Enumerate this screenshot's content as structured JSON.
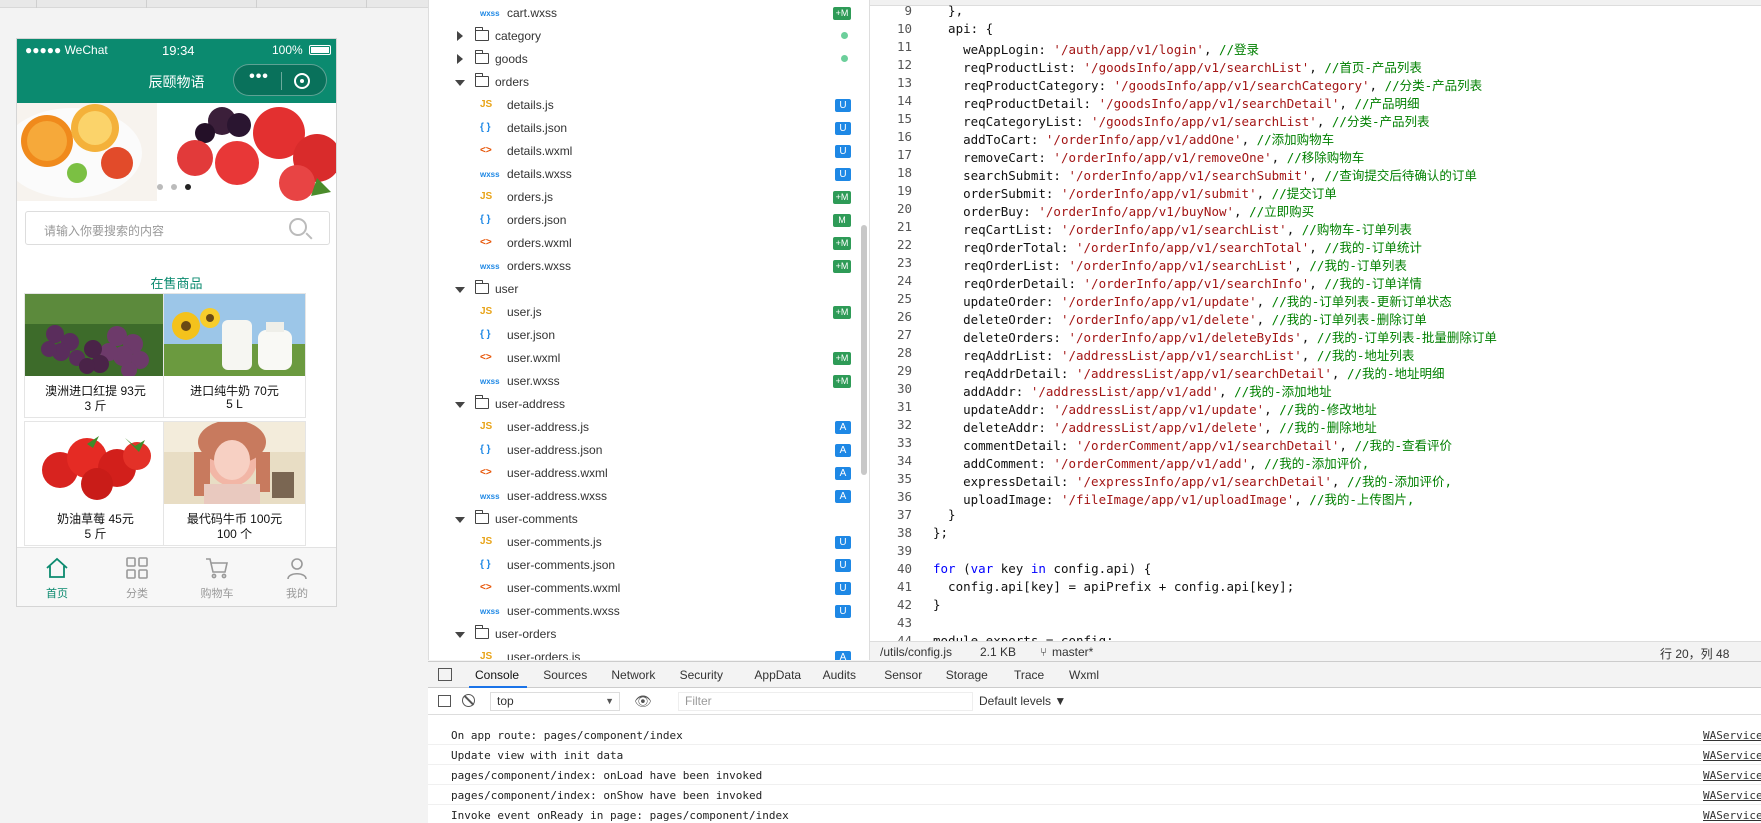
{
  "phone": {
    "carrier": "●●●●● WeChat",
    "time": "19:34",
    "battery": "100%",
    "nav_title": "辰颐物语",
    "search_placeholder": "请输入你要搜索的内容",
    "section_title": "在售商品",
    "goods": [
      {
        "name": "澳洲进口红提 93元",
        "unit": "3 斤"
      },
      {
        "name": "进口纯牛奶 70元",
        "unit": "5 L"
      },
      {
        "name": "奶油草莓 45元",
        "unit": "5 斤"
      },
      {
        "name": "最代码牛币 100元",
        "unit": "100 个"
      }
    ],
    "tabs": [
      "首页",
      "分类",
      "购物车",
      "我的"
    ],
    "accent_color": "#0b8a6f"
  },
  "tree": [
    {
      "kind": "file",
      "type": "wxss",
      "label": "cart.wxss",
      "badge": "+M",
      "indent": 2
    },
    {
      "kind": "folder",
      "open": false,
      "label": "category",
      "badge": "dot",
      "indent": 1
    },
    {
      "kind": "folder",
      "open": false,
      "label": "goods",
      "badge": "dot",
      "indent": 1
    },
    {
      "kind": "folder",
      "open": true,
      "label": "orders",
      "badge": "",
      "indent": 1
    },
    {
      "kind": "file",
      "type": "js",
      "label": "details.js",
      "badge": "U",
      "indent": 2
    },
    {
      "kind": "file",
      "type": "json",
      "label": "details.json",
      "badge": "U",
      "indent": 2
    },
    {
      "kind": "file",
      "type": "wxml",
      "label": "details.wxml",
      "badge": "U",
      "indent": 2
    },
    {
      "kind": "file",
      "type": "wxss",
      "label": "details.wxss",
      "badge": "U",
      "indent": 2
    },
    {
      "kind": "file",
      "type": "js",
      "label": "orders.js",
      "badge": "+M",
      "indent": 2
    },
    {
      "kind": "file",
      "type": "json",
      "label": "orders.json",
      "badge": "M",
      "indent": 2
    },
    {
      "kind": "file",
      "type": "wxml",
      "label": "orders.wxml",
      "badge": "+M",
      "indent": 2
    },
    {
      "kind": "file",
      "type": "wxss",
      "label": "orders.wxss",
      "badge": "+M",
      "indent": 2
    },
    {
      "kind": "folder",
      "open": true,
      "label": "user",
      "badge": "",
      "indent": 1
    },
    {
      "kind": "file",
      "type": "js",
      "label": "user.js",
      "badge": "+M",
      "indent": 2
    },
    {
      "kind": "file",
      "type": "json",
      "label": "user.json",
      "badge": "",
      "indent": 2
    },
    {
      "kind": "file",
      "type": "wxml",
      "label": "user.wxml",
      "badge": "+M",
      "indent": 2
    },
    {
      "kind": "file",
      "type": "wxss",
      "label": "user.wxss",
      "badge": "+M",
      "indent": 2
    },
    {
      "kind": "folder",
      "open": true,
      "label": "user-address",
      "badge": "",
      "indent": 1
    },
    {
      "kind": "file",
      "type": "js",
      "label": "user-address.js",
      "badge": "A",
      "indent": 2
    },
    {
      "kind": "file",
      "type": "json",
      "label": "user-address.json",
      "badge": "A",
      "indent": 2
    },
    {
      "kind": "file",
      "type": "wxml",
      "label": "user-address.wxml",
      "badge": "A",
      "indent": 2
    },
    {
      "kind": "file",
      "type": "wxss",
      "label": "user-address.wxss",
      "badge": "A",
      "indent": 2
    },
    {
      "kind": "folder",
      "open": true,
      "label": "user-comments",
      "badge": "",
      "indent": 1
    },
    {
      "kind": "file",
      "type": "js",
      "label": "user-comments.js",
      "badge": "U",
      "indent": 2
    },
    {
      "kind": "file",
      "type": "json",
      "label": "user-comments.json",
      "badge": "U",
      "indent": 2
    },
    {
      "kind": "file",
      "type": "wxml",
      "label": "user-comments.wxml",
      "badge": "U",
      "indent": 2
    },
    {
      "kind": "file",
      "type": "wxss",
      "label": "user-comments.wxss",
      "badge": "U",
      "indent": 2
    },
    {
      "kind": "folder",
      "open": true,
      "label": "user-orders",
      "badge": "",
      "indent": 1
    },
    {
      "kind": "file",
      "type": "js",
      "label": "user-orders.js",
      "badge": "A",
      "indent": 2
    }
  ],
  "filetype_icons": {
    "js": {
      "text": "JS",
      "color": "#e8a317"
    },
    "json": {
      "text": "{ }",
      "color": "#1e88e5"
    },
    "wxml": {
      "text": "<>",
      "color": "#e65100"
    },
    "wxss": {
      "text": "wxss",
      "color": "#1e88e5"
    }
  },
  "code": [
    {
      "n": "9",
      "segs": [
        [
          "p",
          "  },"
        ]
      ]
    },
    {
      "n": "10",
      "segs": [
        [
          "p",
          "  api: {"
        ]
      ]
    },
    {
      "n": "11",
      "segs": [
        [
          "p",
          "    weAppLogin: "
        ],
        [
          "s",
          "'/auth/app/v1/login'"
        ],
        [
          "p",
          ", "
        ],
        [
          "c",
          "//登录"
        ]
      ]
    },
    {
      "n": "12",
      "segs": [
        [
          "p",
          "    reqProductList: "
        ],
        [
          "s",
          "'/goodsInfo/app/v1/searchList'"
        ],
        [
          "p",
          ", "
        ],
        [
          "c",
          "//首页-产品列表"
        ]
      ]
    },
    {
      "n": "13",
      "segs": [
        [
          "p",
          "    reqProductCategory: "
        ],
        [
          "s",
          "'/goodsInfo/app/v1/searchCategory'"
        ],
        [
          "p",
          ", "
        ],
        [
          "c",
          "//分类-产品列表"
        ]
      ]
    },
    {
      "n": "14",
      "segs": [
        [
          "p",
          "    reqProductDetail: "
        ],
        [
          "s",
          "'/goodsInfo/app/v1/searchDetail'"
        ],
        [
          "p",
          ", "
        ],
        [
          "c",
          "//产品明细"
        ]
      ]
    },
    {
      "n": "15",
      "segs": [
        [
          "p",
          "    reqCategoryList: "
        ],
        [
          "s",
          "'/goodsInfo/app/v1/searchList'"
        ],
        [
          "p",
          ", "
        ],
        [
          "c",
          "//分类-产品列表"
        ]
      ]
    },
    {
      "n": "16",
      "segs": [
        [
          "p",
          "    addToCart: "
        ],
        [
          "s",
          "'/orderInfo/app/v1/addOne'"
        ],
        [
          "p",
          ", "
        ],
        [
          "c",
          "//添加购物车"
        ]
      ]
    },
    {
      "n": "17",
      "segs": [
        [
          "p",
          "    removeCart: "
        ],
        [
          "s",
          "'/orderInfo/app/v1/removeOne'"
        ],
        [
          "p",
          ", "
        ],
        [
          "c",
          "//移除购物车"
        ]
      ]
    },
    {
      "n": "18",
      "segs": [
        [
          "p",
          "    searchSubmit: "
        ],
        [
          "s",
          "'/orderInfo/app/v1/searchSubmit'"
        ],
        [
          "p",
          ", "
        ],
        [
          "c",
          "//查询提交后待确认的订单"
        ]
      ]
    },
    {
      "n": "19",
      "segs": [
        [
          "p",
          "    orderSubmit: "
        ],
        [
          "s",
          "'/orderInfo/app/v1/submit'"
        ],
        [
          "p",
          ", "
        ],
        [
          "c",
          "//提交订单"
        ]
      ]
    },
    {
      "n": "20",
      "segs": [
        [
          "p",
          "    orderBuy: "
        ],
        [
          "s",
          "'/orderInfo/app/v1/buyNow'"
        ],
        [
          "p",
          ", "
        ],
        [
          "c",
          "//立即购买"
        ]
      ]
    },
    {
      "n": "21",
      "segs": [
        [
          "p",
          "    reqCartList: "
        ],
        [
          "s",
          "'/orderInfo/app/v1/searchList'"
        ],
        [
          "p",
          ", "
        ],
        [
          "c",
          "//购物车-订单列表"
        ]
      ]
    },
    {
      "n": "22",
      "segs": [
        [
          "p",
          "    reqOrderTotal: "
        ],
        [
          "s",
          "'/orderInfo/app/v1/searchTotal'"
        ],
        [
          "p",
          ", "
        ],
        [
          "c",
          "//我的-订单统计"
        ]
      ]
    },
    {
      "n": "23",
      "segs": [
        [
          "p",
          "    reqOrderList: "
        ],
        [
          "s",
          "'/orderInfo/app/v1/searchList'"
        ],
        [
          "p",
          ", "
        ],
        [
          "c",
          "//我的-订单列表"
        ]
      ]
    },
    {
      "n": "24",
      "segs": [
        [
          "p",
          "    reqOrderDetail: "
        ],
        [
          "s",
          "'/orderInfo/app/v1/searchInfo'"
        ],
        [
          "p",
          ", "
        ],
        [
          "c",
          "//我的-订单详情"
        ]
      ]
    },
    {
      "n": "25",
      "segs": [
        [
          "p",
          "    updateOrder: "
        ],
        [
          "s",
          "'/orderInfo/app/v1/update'"
        ],
        [
          "p",
          ", "
        ],
        [
          "c",
          "//我的-订单列表-更新订单状态"
        ]
      ]
    },
    {
      "n": "26",
      "segs": [
        [
          "p",
          "    deleteOrder: "
        ],
        [
          "s",
          "'/orderInfo/app/v1/delete'"
        ],
        [
          "p",
          ", "
        ],
        [
          "c",
          "//我的-订单列表-删除订单"
        ]
      ]
    },
    {
      "n": "27",
      "segs": [
        [
          "p",
          "    deleteOrders: "
        ],
        [
          "s",
          "'/orderInfo/app/v1/deleteByIds'"
        ],
        [
          "p",
          ", "
        ],
        [
          "c",
          "//我的-订单列表-批量删除订单"
        ]
      ]
    },
    {
      "n": "28",
      "segs": [
        [
          "p",
          "    reqAddrList: "
        ],
        [
          "s",
          "'/addressList/app/v1/searchList'"
        ],
        [
          "p",
          ", "
        ],
        [
          "c",
          "//我的-地址列表"
        ]
      ]
    },
    {
      "n": "29",
      "segs": [
        [
          "p",
          "    reqAddrDetail: "
        ],
        [
          "s",
          "'/addressList/app/v1/searchDetail'"
        ],
        [
          "p",
          ", "
        ],
        [
          "c",
          "//我的-地址明细"
        ]
      ]
    },
    {
      "n": "30",
      "segs": [
        [
          "p",
          "    addAddr: "
        ],
        [
          "s",
          "'/addressList/app/v1/add'"
        ],
        [
          "p",
          ", "
        ],
        [
          "c",
          "//我的-添加地址"
        ]
      ]
    },
    {
      "n": "31",
      "segs": [
        [
          "p",
          "    updateAddr: "
        ],
        [
          "s",
          "'/addressList/app/v1/update'"
        ],
        [
          "p",
          ", "
        ],
        [
          "c",
          "//我的-修改地址"
        ]
      ]
    },
    {
      "n": "32",
      "segs": [
        [
          "p",
          "    deleteAddr: "
        ],
        [
          "s",
          "'/addressList/app/v1/delete'"
        ],
        [
          "p",
          ", "
        ],
        [
          "c",
          "//我的-删除地址"
        ]
      ]
    },
    {
      "n": "33",
      "segs": [
        [
          "p",
          "    commentDetail: "
        ],
        [
          "s",
          "'/orderComment/app/v1/searchDetail'"
        ],
        [
          "p",
          ", "
        ],
        [
          "c",
          "//我的-查看评价"
        ]
      ]
    },
    {
      "n": "34",
      "segs": [
        [
          "p",
          "    addComment: "
        ],
        [
          "s",
          "'/orderComment/app/v1/add'"
        ],
        [
          "p",
          ", "
        ],
        [
          "c",
          "//我的-添加评价,"
        ]
      ]
    },
    {
      "n": "35",
      "segs": [
        [
          "p",
          "    expressDetail: "
        ],
        [
          "s",
          "'/expressInfo/app/v1/searchDetail'"
        ],
        [
          "p",
          ", "
        ],
        [
          "c",
          "//我的-添加评价,"
        ]
      ]
    },
    {
      "n": "36",
      "segs": [
        [
          "p",
          "    uploadImage: "
        ],
        [
          "s",
          "'/fileImage/app/v1/uploadImage'"
        ],
        [
          "p",
          ", "
        ],
        [
          "c",
          "//我的-上传图片,"
        ]
      ]
    },
    {
      "n": "37",
      "segs": [
        [
          "p",
          "  }"
        ]
      ]
    },
    {
      "n": "38",
      "segs": [
        [
          "p",
          "};"
        ]
      ]
    },
    {
      "n": "39",
      "segs": [
        [
          "p",
          ""
        ]
      ]
    },
    {
      "n": "40",
      "segs": [
        [
          "k",
          "for"
        ],
        [
          "p",
          " ("
        ],
        [
          "k",
          "var"
        ],
        [
          "p",
          " key "
        ],
        [
          "k",
          "in"
        ],
        [
          "p",
          " config.api) {"
        ]
      ]
    },
    {
      "n": "41",
      "segs": [
        [
          "p",
          "  config.api[key] = apiPrefix + config.api[key];"
        ]
      ]
    },
    {
      "n": "42",
      "segs": [
        [
          "p",
          "}"
        ]
      ]
    },
    {
      "n": "43",
      "segs": [
        [
          "p",
          ""
        ]
      ]
    },
    {
      "n": "44",
      "segs": [
        [
          "p",
          "module.exports = config;"
        ]
      ]
    }
  ],
  "status": {
    "path": "/utils/config.js",
    "size": "2.1 KB",
    "branch": "master*",
    "cursor": "行 20，列 48"
  },
  "devtools": {
    "tabs": [
      "Console",
      "Sources",
      "Network",
      "Security",
      "AppData",
      "Audits",
      "Sensor",
      "Storage",
      "Trace",
      "Wxml"
    ],
    "active_tab": "Console",
    "context": "top",
    "filter_placeholder": "Filter",
    "levels": "Default levels ▼",
    "logs": [
      {
        "msg": "On app route: pages/component/index",
        "src": "WAService"
      },
      {
        "msg": "Update view with init data",
        "src": "WAService"
      },
      {
        "msg": "pages/component/index: onLoad have been invoked",
        "src": "WAService"
      },
      {
        "msg": "pages/component/index: onShow have been invoked",
        "src": "WAService"
      },
      {
        "msg": "Invoke event onReady in page: pages/component/index",
        "src": "WAService"
      }
    ]
  }
}
